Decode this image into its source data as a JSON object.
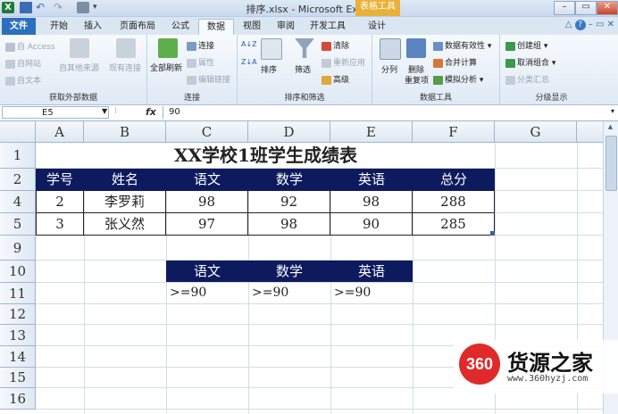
{
  "window": {
    "title": "排序.xlsx - Microsoft Excel",
    "context_tab_title": "表格工具",
    "app_icon_letter": "X",
    "help_glyph": "?"
  },
  "tabs": [
    {
      "label": "文件",
      "active": false
    },
    {
      "label": "开始",
      "active": false
    },
    {
      "label": "插入",
      "active": false
    },
    {
      "label": "页面布局",
      "active": false
    },
    {
      "label": "公式",
      "active": false
    },
    {
      "label": "数据",
      "active": true
    },
    {
      "label": "视图",
      "active": false
    },
    {
      "label": "审阅",
      "active": false
    },
    {
      "label": "开发工具",
      "active": false
    },
    {
      "label": "设计",
      "active": false
    }
  ],
  "ribbon": {
    "groups": {
      "external_data": {
        "label": "获取外部数据",
        "access": "自 Access",
        "web": "自网站",
        "text": "自文本",
        "other_sources": "自其他来源",
        "existing_connections": "现有连接"
      },
      "connections": {
        "label": "连接",
        "refresh_all": "全部刷新",
        "connections": "连接",
        "properties": "属性",
        "edit_links": "编辑链接"
      },
      "sort_filter": {
        "label": "排序和筛选",
        "sort_az": "A↓Z",
        "sort_za": "Z↓A",
        "sort": "排序",
        "filter": "筛选",
        "clear": "清除",
        "reapply": "重新应用",
        "advanced": "高级"
      },
      "data_tools": {
        "label": "数据工具",
        "text_to_columns": "分列",
        "remove_duplicates_1": "删除",
        "remove_duplicates_2": "重复项",
        "data_validation": "数据有效性 ▾",
        "consolidate": "合并计算",
        "what_if": "模拟分析 ▾"
      },
      "outline": {
        "label": "分级显示",
        "group": "创建组 ▾",
        "ungroup": "取消组合 ▾",
        "subtotal": "分类汇总"
      }
    }
  },
  "formula_bar": {
    "name_box": "E5",
    "fx": "fx",
    "value": "90"
  },
  "sheet": {
    "columns": [
      "A",
      "B",
      "C",
      "D",
      "E",
      "F",
      "G"
    ],
    "rows": [
      "1",
      "2",
      "4",
      "5",
      "9",
      "10",
      "11",
      "12",
      "13",
      "14",
      "15",
      "16"
    ],
    "title": "XX学校1班学生成绩表",
    "header": [
      "学号",
      "姓名",
      "语文",
      "数学",
      "英语",
      "总分"
    ],
    "data": [
      [
        "2",
        "李罗莉",
        "98",
        "92",
        "98",
        "288"
      ],
      [
        "3",
        "张义然",
        "97",
        "98",
        "90",
        "285"
      ]
    ],
    "criteria_header": [
      "语文",
      "数学",
      "英语"
    ],
    "criteria_values": [
      ">=90",
      ">=90",
      ">=90"
    ]
  },
  "watermark": {
    "logo_text": "360",
    "title": "货源之家",
    "url": "www.360hyzj.com"
  }
}
